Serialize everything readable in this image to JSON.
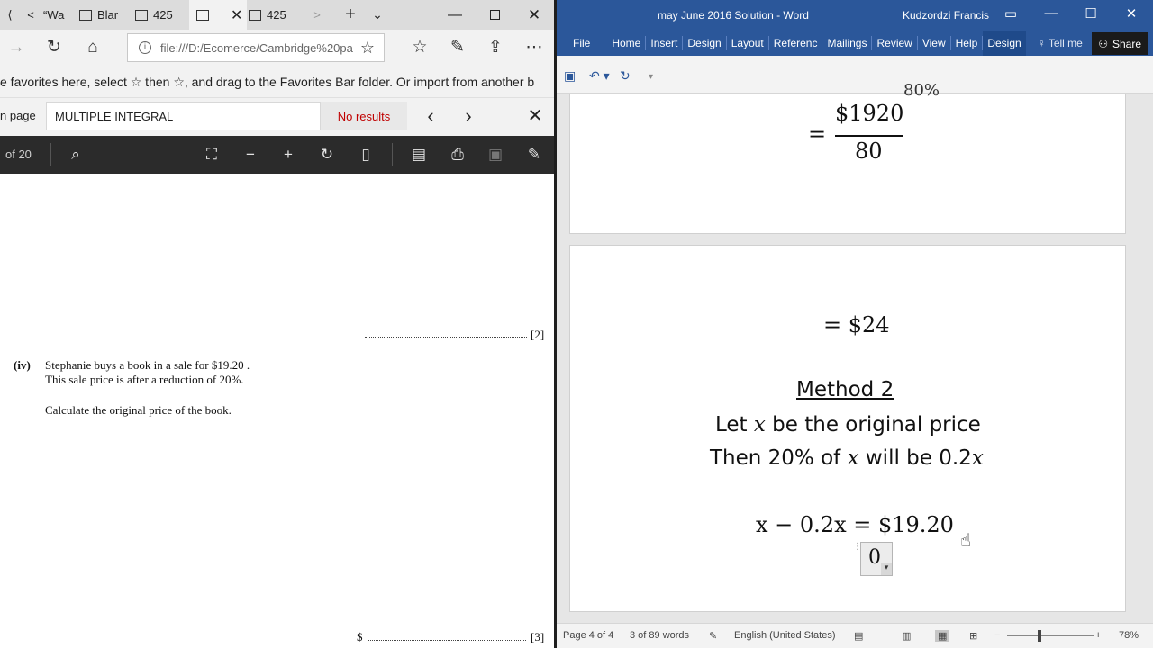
{
  "edge": {
    "tabs": [
      {
        "label": "“Wa"
      },
      {
        "label": "Blar"
      },
      {
        "label": "425"
      },
      {
        "label": ""
      },
      {
        "label": "425"
      }
    ],
    "address": "file:///D:/Ecomerce/Cambridge%20pa",
    "favorites_hint": "e favorites here, select  ☆  then ☆, and drag to the Favorites Bar folder. Or import from another b",
    "find": {
      "label": "n page",
      "query": "MULTIPLE INTEGRAL",
      "result": "No results"
    },
    "pdf_toolbar": {
      "page_of": "of 20"
    },
    "pdf_content": {
      "mark_1": "[2]",
      "question_num": "(iv)",
      "line1": "Stephanie buys a book in a sale for $19.20 .",
      "line2": "This sale price is after a reduction of 20%.",
      "line3": "Calculate the original price of the book.",
      "answer_prefix": "$",
      "mark_2": "[3]"
    }
  },
  "word": {
    "title": "may June 2016 Solution  -  Word",
    "user": "Kudzordzi Francis",
    "ribbon_tabs": [
      "File",
      "Home",
      "Insert",
      "Design",
      "Layout",
      "Referenc",
      "Mailings",
      "Review",
      "View",
      "Help",
      "Design"
    ],
    "tell_me": "Tell me",
    "share": "Share",
    "page1": {
      "partial_top": "80%",
      "numerator": "$1920",
      "denominator": "80",
      "equals": "="
    },
    "page2": {
      "result": "= $24",
      "method_heading": "Method 2",
      "line1_a": "Let ",
      "line1_var": "x",
      "line1_b": " be the original price",
      "line2_a": "Then 20% of ",
      "line2_var": "x",
      "line2_b": " will be 0.2",
      "line2_var2": "x",
      "equation": "x − 0.2x = $19.20",
      "placeholder": "0"
    },
    "status": {
      "page": "Page 4 of 4",
      "words": "3 of 89 words",
      "language": "English (United States)",
      "zoom": "78%"
    }
  }
}
